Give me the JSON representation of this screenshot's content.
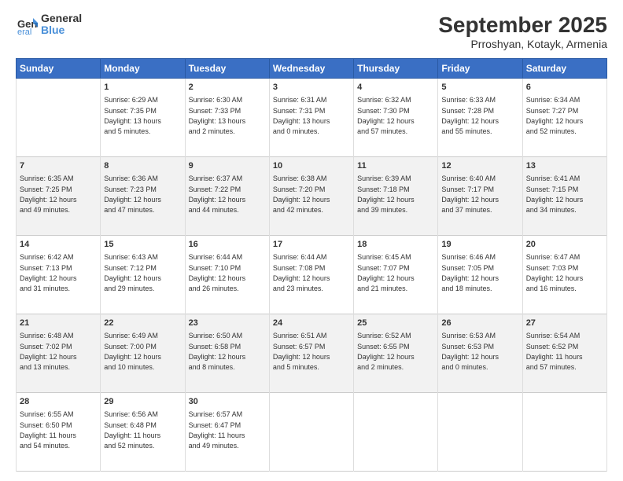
{
  "header": {
    "logo_line1": "General",
    "logo_line2": "Blue",
    "title": "September 2025",
    "subtitle": "Prroshyan, Kotayk, Armenia"
  },
  "columns": [
    "Sunday",
    "Monday",
    "Tuesday",
    "Wednesday",
    "Thursday",
    "Friday",
    "Saturday"
  ],
  "weeks": [
    [
      {
        "date": "",
        "text": ""
      },
      {
        "date": "1",
        "text": "Sunrise: 6:29 AM\nSunset: 7:35 PM\nDaylight: 13 hours\nand 5 minutes."
      },
      {
        "date": "2",
        "text": "Sunrise: 6:30 AM\nSunset: 7:33 PM\nDaylight: 13 hours\nand 2 minutes."
      },
      {
        "date": "3",
        "text": "Sunrise: 6:31 AM\nSunset: 7:31 PM\nDaylight: 13 hours\nand 0 minutes."
      },
      {
        "date": "4",
        "text": "Sunrise: 6:32 AM\nSunset: 7:30 PM\nDaylight: 12 hours\nand 57 minutes."
      },
      {
        "date": "5",
        "text": "Sunrise: 6:33 AM\nSunset: 7:28 PM\nDaylight: 12 hours\nand 55 minutes."
      },
      {
        "date": "6",
        "text": "Sunrise: 6:34 AM\nSunset: 7:27 PM\nDaylight: 12 hours\nand 52 minutes."
      }
    ],
    [
      {
        "date": "7",
        "text": "Sunrise: 6:35 AM\nSunset: 7:25 PM\nDaylight: 12 hours\nand 49 minutes."
      },
      {
        "date": "8",
        "text": "Sunrise: 6:36 AM\nSunset: 7:23 PM\nDaylight: 12 hours\nand 47 minutes."
      },
      {
        "date": "9",
        "text": "Sunrise: 6:37 AM\nSunset: 7:22 PM\nDaylight: 12 hours\nand 44 minutes."
      },
      {
        "date": "10",
        "text": "Sunrise: 6:38 AM\nSunset: 7:20 PM\nDaylight: 12 hours\nand 42 minutes."
      },
      {
        "date": "11",
        "text": "Sunrise: 6:39 AM\nSunset: 7:18 PM\nDaylight: 12 hours\nand 39 minutes."
      },
      {
        "date": "12",
        "text": "Sunrise: 6:40 AM\nSunset: 7:17 PM\nDaylight: 12 hours\nand 37 minutes."
      },
      {
        "date": "13",
        "text": "Sunrise: 6:41 AM\nSunset: 7:15 PM\nDaylight: 12 hours\nand 34 minutes."
      }
    ],
    [
      {
        "date": "14",
        "text": "Sunrise: 6:42 AM\nSunset: 7:13 PM\nDaylight: 12 hours\nand 31 minutes."
      },
      {
        "date": "15",
        "text": "Sunrise: 6:43 AM\nSunset: 7:12 PM\nDaylight: 12 hours\nand 29 minutes."
      },
      {
        "date": "16",
        "text": "Sunrise: 6:44 AM\nSunset: 7:10 PM\nDaylight: 12 hours\nand 26 minutes."
      },
      {
        "date": "17",
        "text": "Sunrise: 6:44 AM\nSunset: 7:08 PM\nDaylight: 12 hours\nand 23 minutes."
      },
      {
        "date": "18",
        "text": "Sunrise: 6:45 AM\nSunset: 7:07 PM\nDaylight: 12 hours\nand 21 minutes."
      },
      {
        "date": "19",
        "text": "Sunrise: 6:46 AM\nSunset: 7:05 PM\nDaylight: 12 hours\nand 18 minutes."
      },
      {
        "date": "20",
        "text": "Sunrise: 6:47 AM\nSunset: 7:03 PM\nDaylight: 12 hours\nand 16 minutes."
      }
    ],
    [
      {
        "date": "21",
        "text": "Sunrise: 6:48 AM\nSunset: 7:02 PM\nDaylight: 12 hours\nand 13 minutes."
      },
      {
        "date": "22",
        "text": "Sunrise: 6:49 AM\nSunset: 7:00 PM\nDaylight: 12 hours\nand 10 minutes."
      },
      {
        "date": "23",
        "text": "Sunrise: 6:50 AM\nSunset: 6:58 PM\nDaylight: 12 hours\nand 8 minutes."
      },
      {
        "date": "24",
        "text": "Sunrise: 6:51 AM\nSunset: 6:57 PM\nDaylight: 12 hours\nand 5 minutes."
      },
      {
        "date": "25",
        "text": "Sunrise: 6:52 AM\nSunset: 6:55 PM\nDaylight: 12 hours\nand 2 minutes."
      },
      {
        "date": "26",
        "text": "Sunrise: 6:53 AM\nSunset: 6:53 PM\nDaylight: 12 hours\nand 0 minutes."
      },
      {
        "date": "27",
        "text": "Sunrise: 6:54 AM\nSunset: 6:52 PM\nDaylight: 11 hours\nand 57 minutes."
      }
    ],
    [
      {
        "date": "28",
        "text": "Sunrise: 6:55 AM\nSunset: 6:50 PM\nDaylight: 11 hours\nand 54 minutes."
      },
      {
        "date": "29",
        "text": "Sunrise: 6:56 AM\nSunset: 6:48 PM\nDaylight: 11 hours\nand 52 minutes."
      },
      {
        "date": "30",
        "text": "Sunrise: 6:57 AM\nSunset: 6:47 PM\nDaylight: 11 hours\nand 49 minutes."
      },
      {
        "date": "",
        "text": ""
      },
      {
        "date": "",
        "text": ""
      },
      {
        "date": "",
        "text": ""
      },
      {
        "date": "",
        "text": ""
      }
    ]
  ]
}
